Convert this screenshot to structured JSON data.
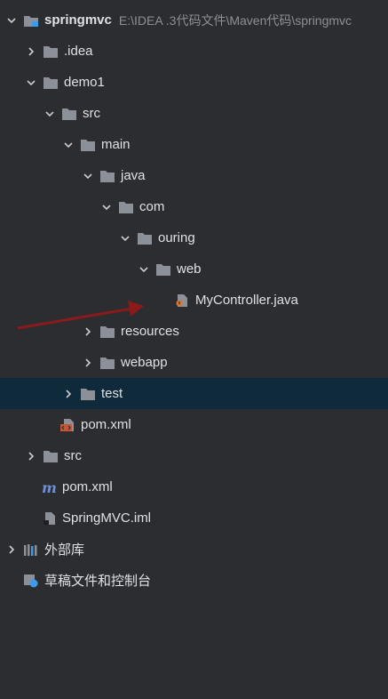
{
  "project": {
    "name": "springmvc",
    "path": "E:\\IDEA .3代码文件\\Maven代码\\springmvc"
  },
  "tree": {
    "idea": ".idea",
    "demo1": "demo1",
    "src": "src",
    "main": "main",
    "java": "java",
    "com": "com",
    "ouring": "ouring",
    "web": "web",
    "my_controller": "MyController.java",
    "resources": "resources",
    "webapp": "webapp",
    "test": "test",
    "demo1_pom": "pom.xml",
    "root_src": "src",
    "root_pom": "pom.xml",
    "iml": "SpringMVC.iml",
    "external_libraries": "外部库",
    "scratches": "草稿文件和控制台"
  },
  "colors": {
    "background": "#2b2d30",
    "selected_row": "#0f2a3a",
    "folder": "#8c9199",
    "annotation_arrow": "#8b1a1a",
    "java_badge": "#d9772e",
    "maven_m": "#6e8fd6",
    "xml_badge": "#c2573a"
  }
}
